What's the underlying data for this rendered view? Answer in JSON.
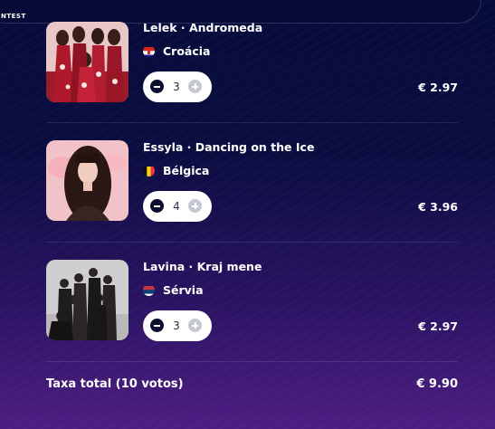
{
  "header": {
    "brand_fragment": "NTEST"
  },
  "cart": {
    "items": [
      {
        "song": "Lelek · Andromeda",
        "country": "Croácia",
        "flag": "croatia-flag-icon",
        "quantity": "3",
        "price": "€ 2.97"
      },
      {
        "song": "Essyla · Dancing on the Ice",
        "country": "Bélgica",
        "flag": "belgium-flag-icon",
        "quantity": "4",
        "price": "€ 3.96"
      },
      {
        "song": "Lavina · Kraj mene",
        "country": "Sérvia",
        "flag": "serbia-flag-icon",
        "quantity": "3",
        "price": "€ 2.97"
      }
    ],
    "total_label": "Taxa total (10 votos)",
    "total_value": "€ 9.90"
  },
  "colors": {
    "background_top": "#060c3c",
    "background_bottom": "#4d1e82",
    "stepper_bg": "#ffffff",
    "minus_button": "#0b0d2e",
    "plus_button_disabled": "#c5c8d2"
  }
}
